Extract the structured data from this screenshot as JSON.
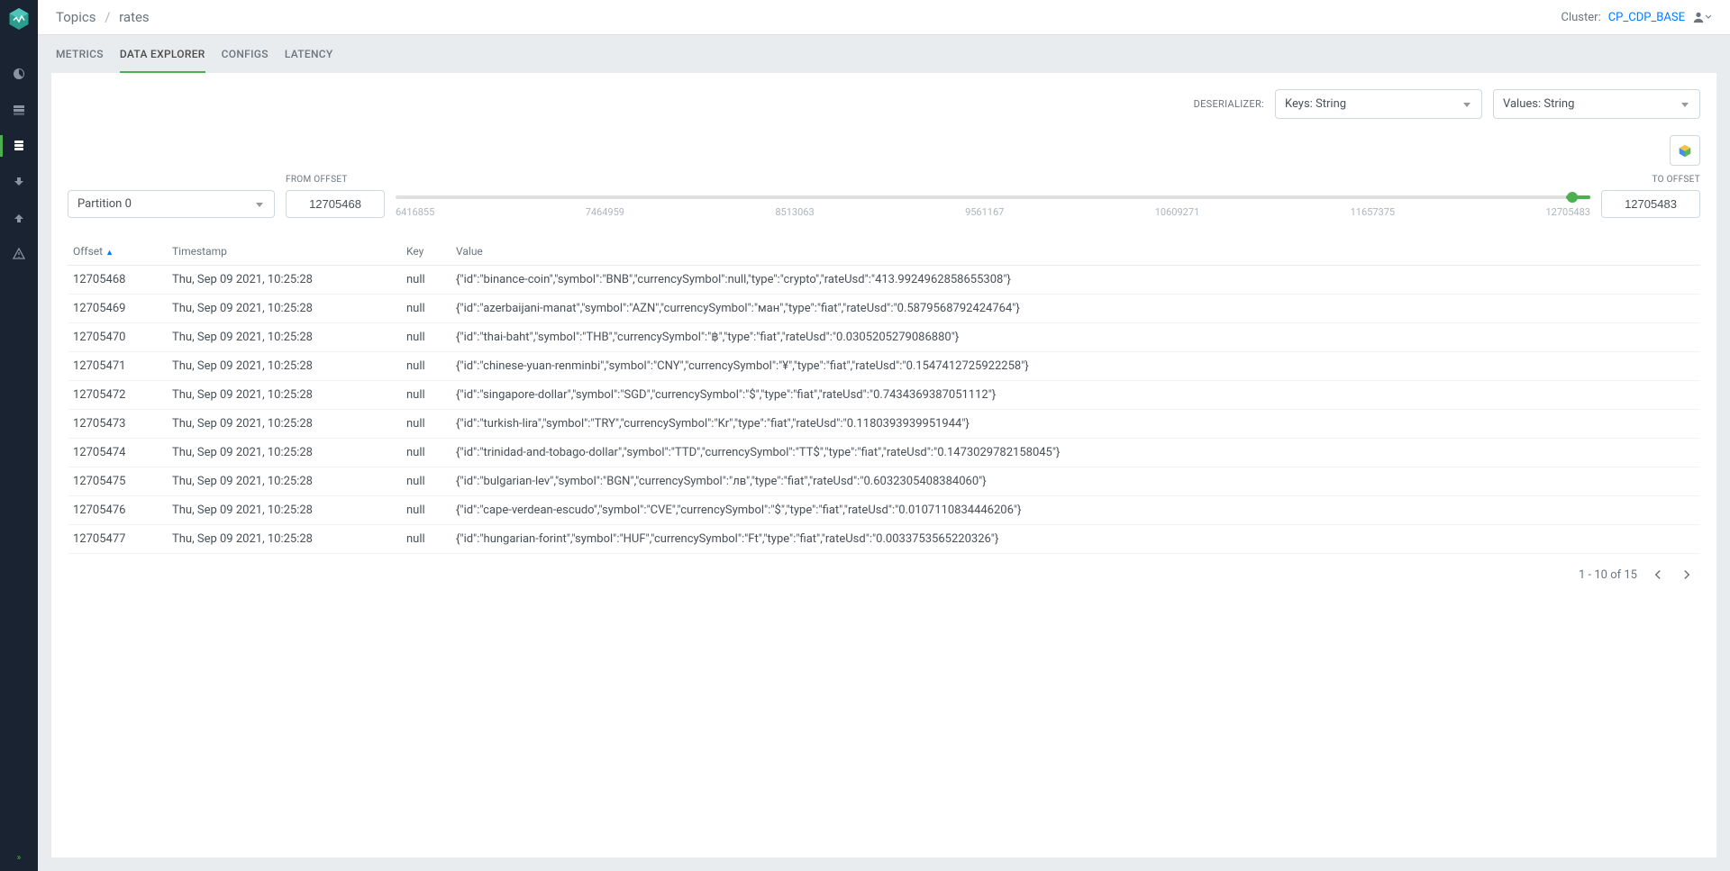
{
  "breadcrumb": {
    "root": "Topics",
    "current": "rates"
  },
  "cluster": {
    "label": "Cluster:",
    "name": "CP_CDP_BASE"
  },
  "tabs": [
    {
      "id": "metrics",
      "label": "METRICS"
    },
    {
      "id": "data-explorer",
      "label": "DATA EXPLORER",
      "active": true
    },
    {
      "id": "configs",
      "label": "CONFIGS"
    },
    {
      "id": "latency",
      "label": "LATENCY"
    }
  ],
  "deserializer": {
    "label": "DESERIALIZER:",
    "keys": "Keys: String",
    "values": "Values: String"
  },
  "partition": {
    "selected": "Partition 0"
  },
  "offsets": {
    "from_label": "FROM OFFSET",
    "to_label": "TO OFFSET",
    "from": "12705468",
    "to": "12705483",
    "ticks": [
      "6416855",
      "7464959",
      "8513063",
      "9561167",
      "10609271",
      "11657375",
      "12705483"
    ]
  },
  "table": {
    "headers": {
      "offset": "Offset",
      "timestamp": "Timestamp",
      "key": "Key",
      "value": "Value"
    },
    "rows": [
      {
        "offset": "12705468",
        "timestamp": "Thu, Sep 09 2021, 10:25:28",
        "key": "null",
        "value": "{\"id\":\"binance-coin\",\"symbol\":\"BNB\",\"currencySymbol\":null,\"type\":\"crypto\",\"rateUsd\":\"413.9924962858655308\"}"
      },
      {
        "offset": "12705469",
        "timestamp": "Thu, Sep 09 2021, 10:25:28",
        "key": "null",
        "value": "{\"id\":\"azerbaijani-manat\",\"symbol\":\"AZN\",\"currencySymbol\":\"ман\",\"type\":\"fiat\",\"rateUsd\":\"0.5879568792424764\"}"
      },
      {
        "offset": "12705470",
        "timestamp": "Thu, Sep 09 2021, 10:25:28",
        "key": "null",
        "value": "{\"id\":\"thai-baht\",\"symbol\":\"THB\",\"currencySymbol\":\"฿\",\"type\":\"fiat\",\"rateUsd\":\"0.0305205279086880\"}"
      },
      {
        "offset": "12705471",
        "timestamp": "Thu, Sep 09 2021, 10:25:28",
        "key": "null",
        "value": "{\"id\":\"chinese-yuan-renminbi\",\"symbol\":\"CNY\",\"currencySymbol\":\"¥\",\"type\":\"fiat\",\"rateUsd\":\"0.1547412725922258\"}"
      },
      {
        "offset": "12705472",
        "timestamp": "Thu, Sep 09 2021, 10:25:28",
        "key": "null",
        "value": "{\"id\":\"singapore-dollar\",\"symbol\":\"SGD\",\"currencySymbol\":\"$\",\"type\":\"fiat\",\"rateUsd\":\"0.7434369387051112\"}"
      },
      {
        "offset": "12705473",
        "timestamp": "Thu, Sep 09 2021, 10:25:28",
        "key": "null",
        "value": "{\"id\":\"turkish-lira\",\"symbol\":\"TRY\",\"currencySymbol\":\"Kr\",\"type\":\"fiat\",\"rateUsd\":\"0.1180393939951944\"}"
      },
      {
        "offset": "12705474",
        "timestamp": "Thu, Sep 09 2021, 10:25:28",
        "key": "null",
        "value": "{\"id\":\"trinidad-and-tobago-dollar\",\"symbol\":\"TTD\",\"currencySymbol\":\"TT$\",\"type\":\"fiat\",\"rateUsd\":\"0.1473029782158045\"}"
      },
      {
        "offset": "12705475",
        "timestamp": "Thu, Sep 09 2021, 10:25:28",
        "key": "null",
        "value": "{\"id\":\"bulgarian-lev\",\"symbol\":\"BGN\",\"currencySymbol\":\"лв\",\"type\":\"fiat\",\"rateUsd\":\"0.6032305408384060\"}"
      },
      {
        "offset": "12705476",
        "timestamp": "Thu, Sep 09 2021, 10:25:28",
        "key": "null",
        "value": "{\"id\":\"cape-verdean-escudo\",\"symbol\":\"CVE\",\"currencySymbol\":\"$\",\"type\":\"fiat\",\"rateUsd\":\"0.0107110834446206\"}"
      },
      {
        "offset": "12705477",
        "timestamp": "Thu, Sep 09 2021, 10:25:28",
        "key": "null",
        "value": "{\"id\":\"hungarian-forint\",\"symbol\":\"HUF\",\"currencySymbol\":\"Ft\",\"type\":\"fiat\",\"rateUsd\":\"0.0033753565220326\"}"
      }
    ]
  },
  "pagination": {
    "text": "1 - 10 of 15"
  }
}
